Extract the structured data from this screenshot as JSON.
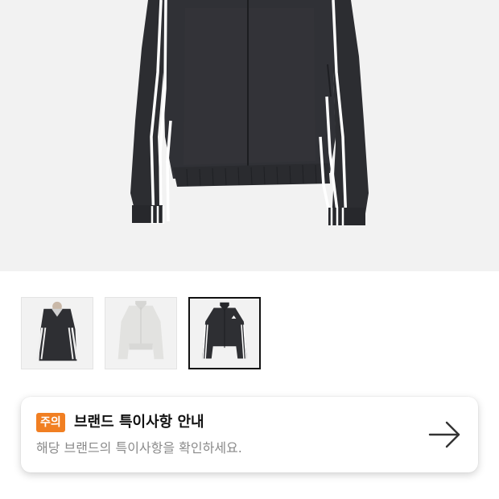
{
  "product": {
    "main_image": {
      "icon": "track-jacket-black-image"
    },
    "thumbnails": [
      {
        "icon": "thumbnail-black-jacket-model",
        "selected": false
      },
      {
        "icon": "thumbnail-white-jacket",
        "selected": false
      },
      {
        "icon": "thumbnail-black-jacket",
        "selected": true
      }
    ]
  },
  "notice": {
    "badge": "주의",
    "title": "브랜드 특이사항 안내",
    "subtitle": "해당 브랜드의 특이사항을 확인하세요.",
    "arrow_icon": "arrow-right-icon",
    "badge_color": "#f17f22"
  }
}
